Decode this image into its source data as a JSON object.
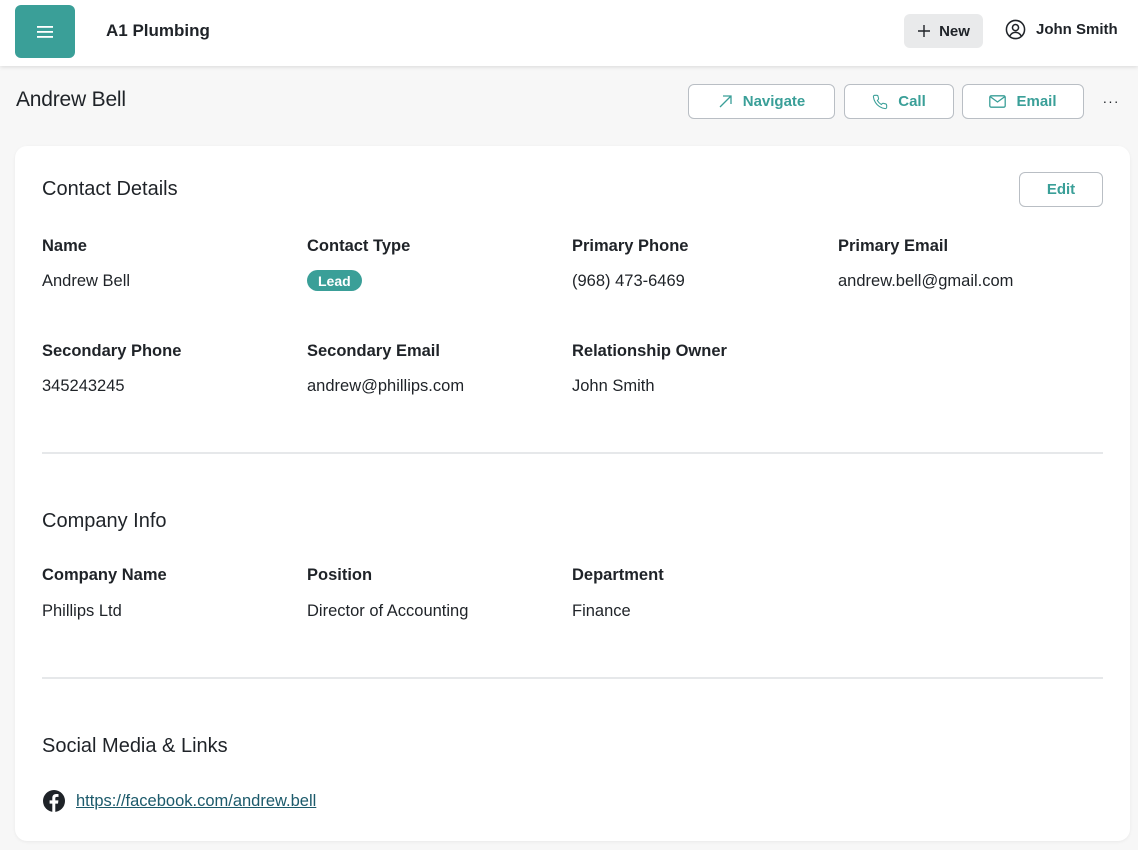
{
  "header": {
    "app_title": "A1 Plumbing",
    "new_label": "New",
    "user_name": "John Smith"
  },
  "page": {
    "title": "Andrew Bell",
    "actions": {
      "navigate": "Navigate",
      "call": "Call",
      "email": "Email",
      "more": "···"
    }
  },
  "contact_details": {
    "title": "Contact Details",
    "edit_label": "Edit",
    "fields": {
      "name": {
        "label": "Name",
        "value": "Andrew Bell"
      },
      "contact_type": {
        "label": "Contact Type",
        "value": "Lead"
      },
      "primary_phone": {
        "label": "Primary Phone",
        "value": "(968) 473-6469"
      },
      "primary_email": {
        "label": "Primary Email",
        "value": "andrew.bell@gmail.com"
      },
      "secondary_phone": {
        "label": "Secondary Phone",
        "value": "345243245"
      },
      "secondary_email": {
        "label": "Secondary Email",
        "value": "andrew@phillips.com"
      },
      "relationship_owner": {
        "label": "Relationship Owner",
        "value": "John Smith"
      }
    }
  },
  "company_info": {
    "title": "Company Info",
    "fields": {
      "company_name": {
        "label": "Company Name",
        "value": "Phillips Ltd"
      },
      "position": {
        "label": "Position",
        "value": "Director of Accounting"
      },
      "department": {
        "label": "Department",
        "value": "Finance"
      }
    }
  },
  "social": {
    "title": "Social Media & Links",
    "links": [
      {
        "icon": "facebook-icon",
        "url": "https://facebook.com/andrew.bell"
      }
    ]
  },
  "colors": {
    "accent": "#3a9f98",
    "link": "#1c5a6b",
    "background": "#f7f7f7"
  }
}
